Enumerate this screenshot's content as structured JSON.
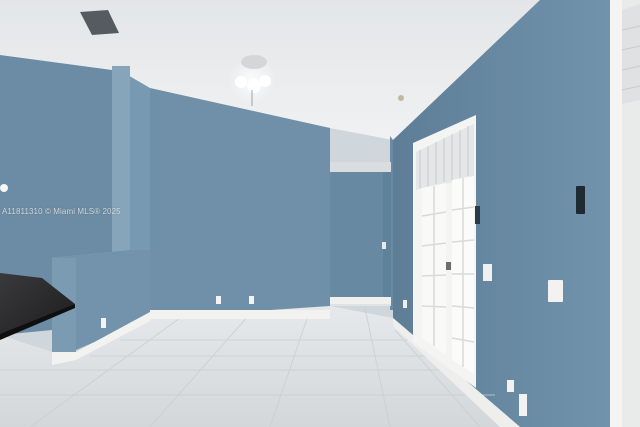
{
  "photo": {
    "subject": "empty room interior with blue walls, tiled floor, ceiling fan and french door",
    "colors": {
      "wall": "#6f90a8",
      "wall_light": "#86a3b9",
      "wall_shadow": "#5b7c94",
      "ceiling": "#e9ecee",
      "floor": "#dde1e4",
      "baseboard": "#f2f2f0",
      "counter": "#2a2a2c",
      "door_frame": "#f4f4f2"
    }
  },
  "watermark": {
    "text": "A11811310 © Miami MLS® 2025"
  }
}
